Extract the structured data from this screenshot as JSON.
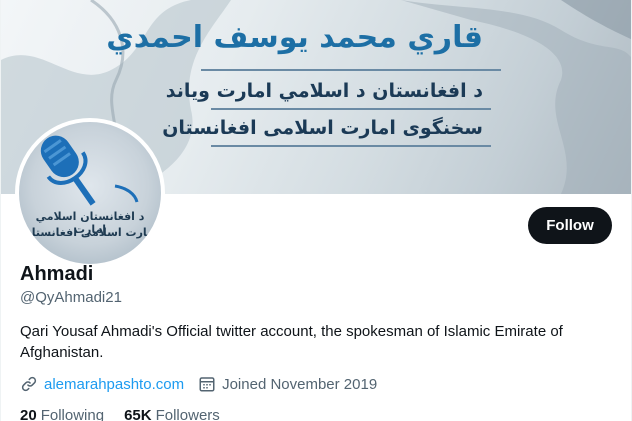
{
  "banner": {
    "title": "قاري محمد يوسف احمدي",
    "line1": "د افغانستان د اسلامي امارت وياند",
    "line2": "سخنگوی امارت اسلامی افغانستان"
  },
  "avatar": {
    "line1": "د افغانستان اسلامي امارت",
    "line2": "امارت اسلامی افغانستان"
  },
  "follow_label": "Follow",
  "profile": {
    "name": "Ahmadi",
    "handle": "@QyAhmadi21",
    "bio": "Qari Yousaf Ahmadi's Official twitter account, the spokesman of Islamic Emirate of Afghanistan.",
    "website": "alemarahpashto.com",
    "joined": "Joined November 2019"
  },
  "stats": {
    "following_count": "20",
    "following_label": "Following",
    "followers_count": "65K",
    "followers_label": "Followers"
  },
  "icons": {
    "link": "link-icon",
    "calendar": "calendar-icon"
  },
  "colors": {
    "accent": "#1d9bf0",
    "text": "#0f1419",
    "secondary": "#536471"
  }
}
